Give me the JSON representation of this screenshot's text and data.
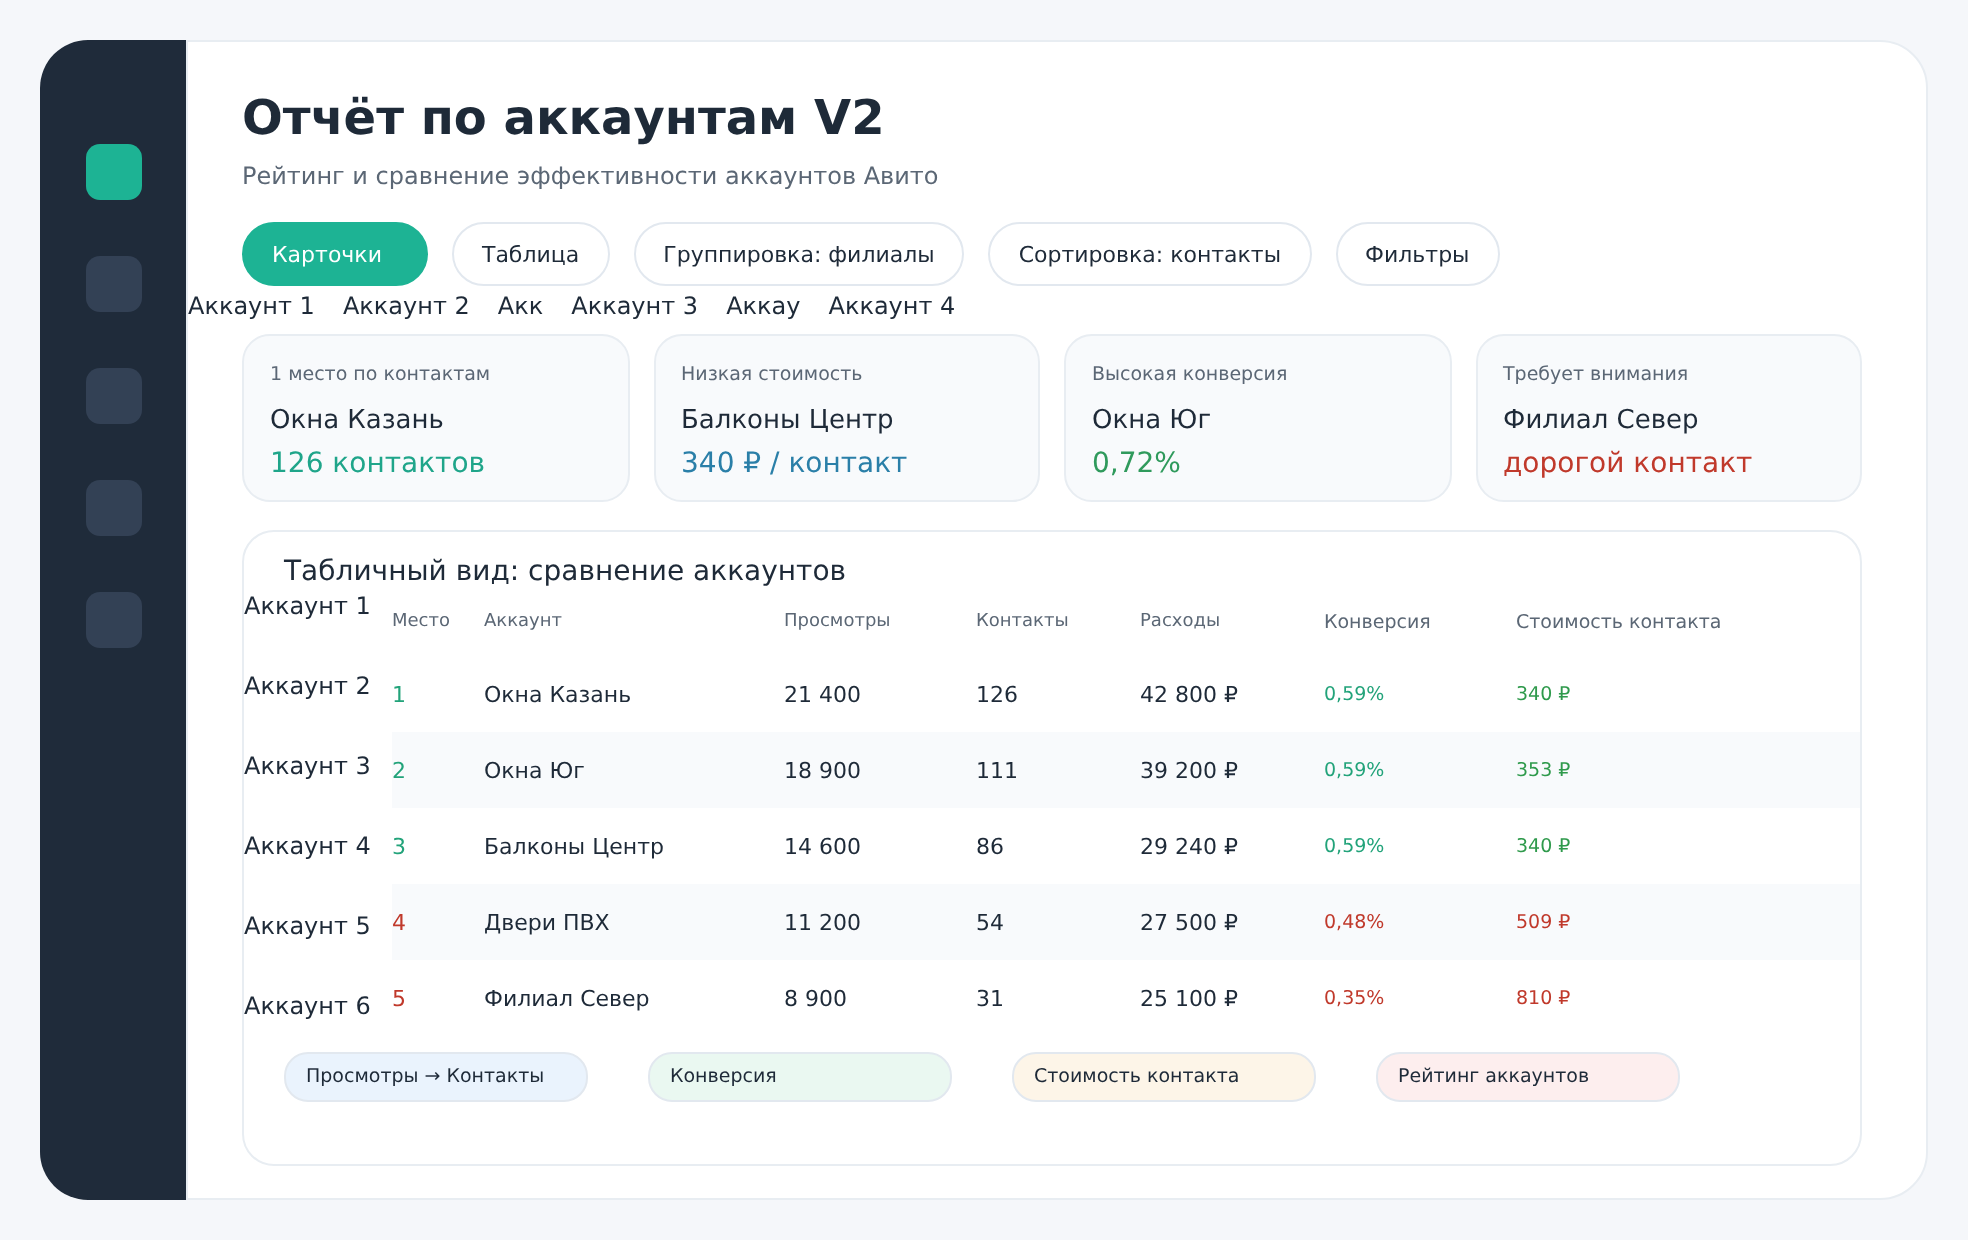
{
  "sidebar": {
    "items": [
      {
        "selected": true
      },
      {
        "selected": false
      },
      {
        "selected": false
      },
      {
        "selected": false
      },
      {
        "selected": false
      }
    ]
  },
  "header": {
    "title": "Отчёт по аккаунтам V2",
    "subtitle": "Рейтинг и сравнение эффективности аккаунтов Авито"
  },
  "tabs": [
    {
      "label": "Карточки",
      "selected": true
    },
    {
      "label": "Таблица",
      "selected": false
    },
    {
      "label": "Группировка: филиалы",
      "selected": false
    },
    {
      "label": "Сортировка: контакты",
      "selected": false
    },
    {
      "label": "Фильтры",
      "selected": false
    }
  ],
  "account_labels_top": [
    "Аккаунт 1",
    "Аккаунт 2",
    "Акк",
    "Аккаунт 3",
    "Аккау",
    "Аккаунт 4"
  ],
  "cards": [
    {
      "caption": "1 место по контактам",
      "name": "Окна Казань",
      "value": "126 контактов",
      "kind": "teal"
    },
    {
      "caption": "Низкая стоимость",
      "name": "Балконы Центр",
      "value": "340 ₽ / контакт",
      "kind": "blue"
    },
    {
      "caption": "Высокая конверсия",
      "name": "Окна Юг",
      "value": "0,72%",
      "kind": "green"
    },
    {
      "caption": "Требует внимания",
      "name": "Филиал Север",
      "value": "дорогой контакт",
      "kind": "red"
    }
  ],
  "table": {
    "title": "Табличный вид: сравнение аккаунтов",
    "account_labels_side": [
      "Аккаунт 1",
      "Аккаунт 2",
      "Аккаунт 3",
      "Аккаунт 4",
      "Аккаунт 5",
      "Аккаунт 6"
    ],
    "columns": [
      "Место",
      "Аккаунт",
      "Просмотры",
      "Контакты",
      "Расходы",
      "Конверсия",
      "Стоимость контакта"
    ],
    "rows": [
      {
        "rank": "1",
        "account": "Окна Казань",
        "views": "21 400",
        "contacts": "126",
        "spend": "42 800 ₽",
        "conversion": "0,59%",
        "cost": "340 ₽",
        "kind": "good"
      },
      {
        "rank": "2",
        "account": "Окна Юг",
        "views": "18 900",
        "contacts": "111",
        "spend": "39 200 ₽",
        "conversion": "0,59%",
        "cost": "353 ₽",
        "kind": "good"
      },
      {
        "rank": "3",
        "account": "Балконы Центр",
        "views": "14 600",
        "contacts": "86",
        "spend": "29 240 ₽",
        "conversion": "0,59%",
        "cost": "340 ₽",
        "kind": "good"
      },
      {
        "rank": "4",
        "account": "Двери ПВХ",
        "views": "11 200",
        "contacts": "54",
        "spend": "27 500 ₽",
        "conversion": "0,48%",
        "cost": "509 ₽",
        "kind": "bad"
      },
      {
        "rank": "5",
        "account": "Филиал Север",
        "views": "8 900",
        "contacts": "31",
        "spend": "25 100 ₽",
        "conversion": "0,35%",
        "cost": "810 ₽",
        "kind": "bad"
      }
    ],
    "legend": [
      {
        "label": "Просмотры → Контакты",
        "color": "#eaf3fd"
      },
      {
        "label": "Конверсия",
        "color": "#eaf8f1"
      },
      {
        "label": "Стоимость контакта",
        "color": "#fdf5e8"
      },
      {
        "label": "Рейтинг аккаунтов",
        "color": "#fdeeee"
      }
    ]
  }
}
